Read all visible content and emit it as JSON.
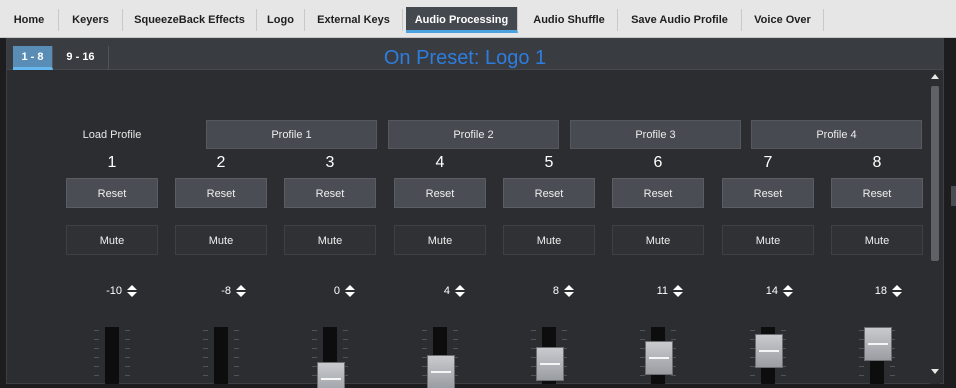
{
  "top_tabs": [
    {
      "label": "Home"
    },
    {
      "label": "Keyers"
    },
    {
      "label": "SqueezeBack Effects"
    },
    {
      "label": "Logo"
    },
    {
      "label": "External Keys"
    },
    {
      "label": "Audio Processing",
      "active": true
    },
    {
      "label": "Audio Shuffle"
    },
    {
      "label": "Save Audio Profile"
    },
    {
      "label": "Voice Over"
    }
  ],
  "sub_tabs": [
    {
      "label": "1 - 8",
      "active": true
    },
    {
      "label": "9 - 16"
    }
  ],
  "preset_title": "On Preset: Logo 1",
  "load_profile_label": "Load Profile",
  "profiles": [
    {
      "label": "Profile 1"
    },
    {
      "label": "Profile 2"
    },
    {
      "label": "Profile 3"
    },
    {
      "label": "Profile 4"
    }
  ],
  "reset_label": "Reset",
  "mute_label": "Mute",
  "channels": [
    {
      "number": "1",
      "gain": "-10",
      "level": 0.0
    },
    {
      "number": "2",
      "gain": "-8",
      "level": 0.0
    },
    {
      "number": "3",
      "gain": "0",
      "level": 0.15
    },
    {
      "number": "4",
      "gain": "4",
      "level": 0.3
    },
    {
      "number": "5",
      "gain": "8",
      "level": 0.45
    },
    {
      "number": "6",
      "gain": "11",
      "level": 0.58
    },
    {
      "number": "7",
      "gain": "14",
      "level": 0.72
    },
    {
      "number": "8",
      "gain": "18",
      "level": 0.88
    }
  ],
  "colors": {
    "accent": "#4aa3df",
    "title": "#2d7de0",
    "active_subtab": "#5a8db5"
  }
}
